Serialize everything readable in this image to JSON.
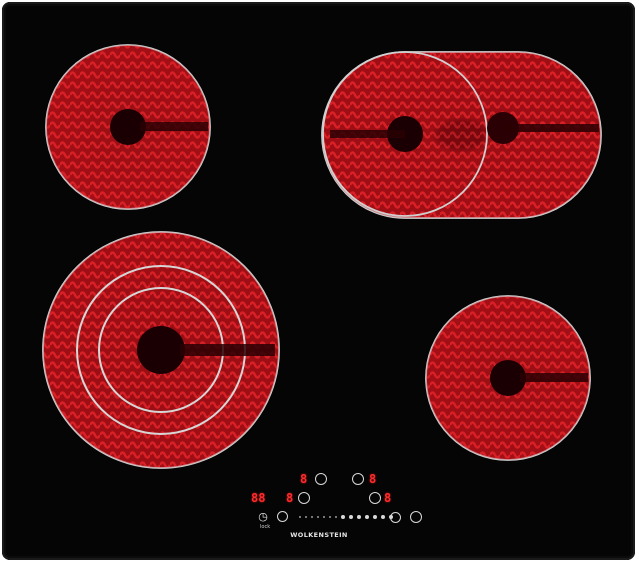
{
  "brand": "WOLKENSTEIN",
  "colors": {
    "glass": "#050505",
    "element_red": "#c8141c",
    "element_dark": "#5a0006",
    "ring": "#d0d0d0",
    "display_red": "#ff2a2a"
  },
  "displays": {
    "zone_front_left": "8",
    "zone_rear_right": "8",
    "timer": "88",
    "zone_front_mid": "8",
    "zone_rear_mid": "8"
  },
  "controls": {
    "timer_icon": "clock-icon",
    "lock_icon": "lock-icon",
    "slider_icon": "slider-dots",
    "boost_icon": "boost-icon",
    "power_icon": "power-icon"
  },
  "sub_label": "lock"
}
